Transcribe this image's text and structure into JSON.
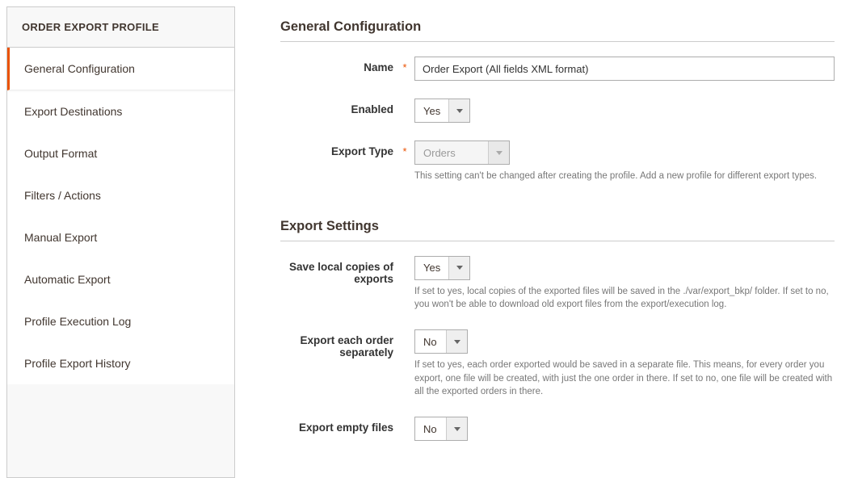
{
  "sidebar": {
    "title": "ORDER EXPORT PROFILE",
    "items": [
      {
        "label": "General Configuration"
      },
      {
        "label": "Export Destinations"
      },
      {
        "label": "Output Format"
      },
      {
        "label": "Filters / Actions"
      },
      {
        "label": "Manual Export"
      },
      {
        "label": "Automatic Export"
      },
      {
        "label": "Profile Execution Log"
      },
      {
        "label": "Profile Export History"
      }
    ]
  },
  "sections": {
    "general": {
      "title": "General Configuration",
      "name_label": "Name",
      "name_value": "Order Export (All fields XML format)",
      "enabled_label": "Enabled",
      "enabled_value": "Yes",
      "type_label": "Export Type",
      "type_value": "Orders",
      "type_helper": "This setting can't be changed after creating the profile. Add a new profile for different export types."
    },
    "settings": {
      "title": "Export Settings",
      "save_local_label": "Save local copies of exports",
      "save_local_value": "Yes",
      "save_local_helper": "If set to yes, local copies of the exported files will be saved in the ./var/export_bkp/ folder. If set to no, you won't be able to download old export files from the export/execution log.",
      "separate_label": "Export each order separately",
      "separate_value": "No",
      "separate_helper": "If set to yes, each order exported would be saved in a separate file. This means, for every order you export, one file will be created, with just the one order in there. If set to no, one file will be created with all the exported orders in there.",
      "empty_label": "Export empty files",
      "empty_value": "No"
    }
  },
  "glyphs": {
    "required": "*"
  }
}
